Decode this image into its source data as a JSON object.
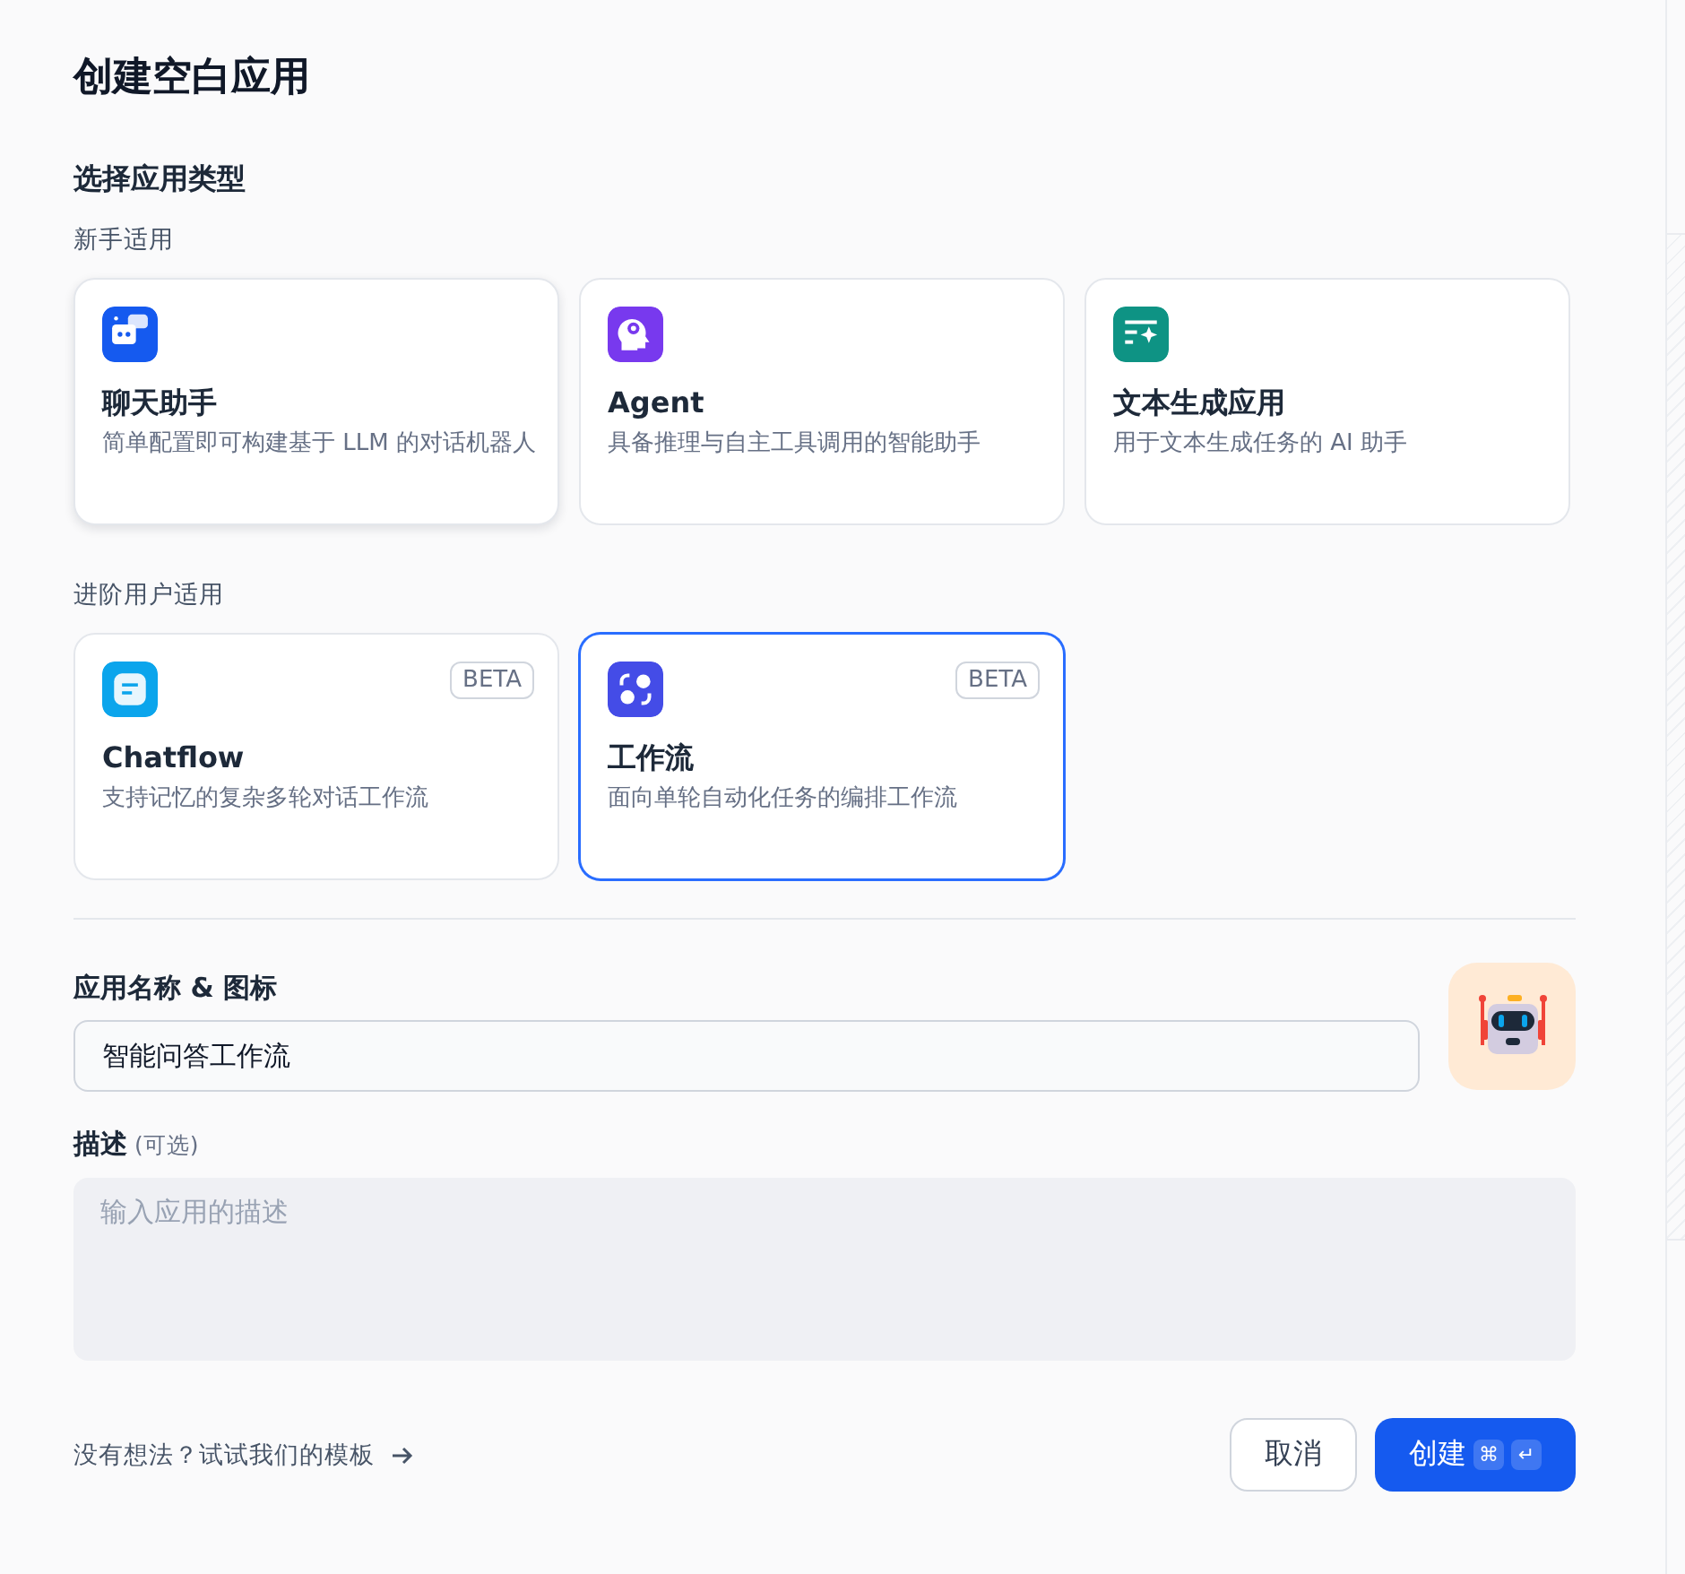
{
  "title": "创建空白应用",
  "section_title": "选择应用类型",
  "groups": [
    {
      "label": "新手适用",
      "cards": [
        {
          "kind": "chat",
          "color": "#155aef",
          "title": "聊天助手",
          "description": "简单配置即可构建基于 LLM 的对话机器人",
          "selected": false,
          "hovered": true
        },
        {
          "kind": "agent",
          "color": "#7839ee",
          "title": "Agent",
          "description": "具备推理与自主工具调用的智能助手",
          "selected": false,
          "hovered": false
        },
        {
          "kind": "text",
          "color": "#0e9384",
          "title": "文本生成应用",
          "description": "用于文本生成任务的 AI 助手",
          "selected": false,
          "hovered": false
        }
      ]
    },
    {
      "label": "进阶用户适用",
      "cards": [
        {
          "kind": "chatflow",
          "color": "#0ba5ec",
          "title": "Chatflow",
          "description": "支持记忆的复杂多轮对话工作流",
          "badge": "BETA",
          "selected": false,
          "hovered": false
        },
        {
          "kind": "workflow",
          "color": "#444ce7",
          "title": "工作流",
          "description": "面向单轮自动化任务的编排工作流",
          "badge": "BETA",
          "selected": true,
          "hovered": false
        }
      ]
    }
  ],
  "name_label": "应用名称 & 图标",
  "name_value": "智能问答工作流",
  "description_label": "描述",
  "description_optional": "(可选)",
  "description_placeholder": "输入应用的描述",
  "template_link": "没有想法？试试我们的模板",
  "cancel_button": "取消",
  "create_button": {
    "label": "创建",
    "keys": [
      "⌘",
      "↵"
    ]
  }
}
